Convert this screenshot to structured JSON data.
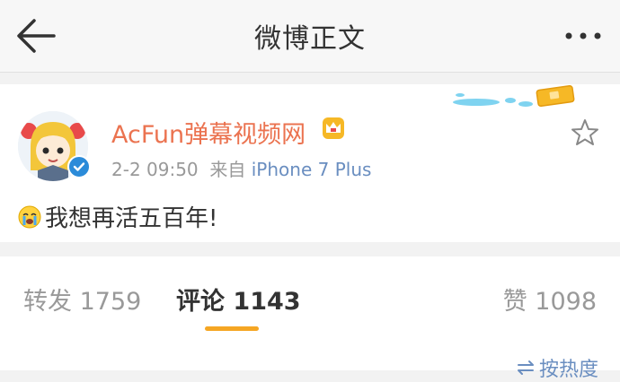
{
  "header": {
    "title": "微博正文",
    "back_icon": "arrow-left-icon",
    "more_icon": "more-dots-icon"
  },
  "post": {
    "username": "AcFun弹幕视频网",
    "time": "2-2 09:50",
    "source_prefix": "来自",
    "device": "iPhone 7 Plus",
    "text": "我想再活五百年!",
    "emoji": "crying-emoji-icon"
  },
  "tabs": {
    "repost_label": "转发",
    "repost_count": "1759",
    "comment_label": "评论",
    "comment_count": "1143",
    "like_label": "赞",
    "like_count": "1098"
  },
  "sort": {
    "label": "按热度"
  },
  "colors": {
    "username": "#eb7350",
    "link": "#6a8ec0",
    "indicator": "#f5a623",
    "verified": "#2b8bd9"
  }
}
